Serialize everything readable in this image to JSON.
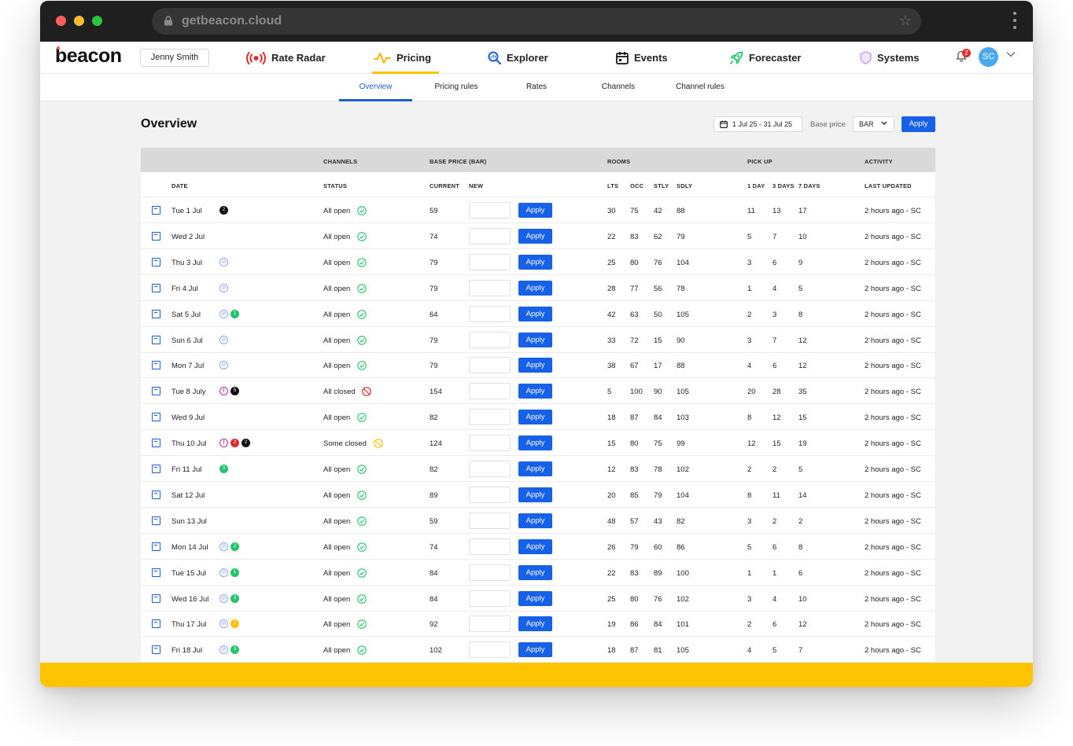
{
  "browser": {
    "url": "getbeacon.cloud"
  },
  "app": {
    "logo": "beacon",
    "user_name": "Jenny Smith",
    "nav": [
      {
        "label": "Rate Radar",
        "icon": "radar-icon"
      },
      {
        "label": "Pricing",
        "icon": "pulse-icon",
        "active": true
      },
      {
        "label": "Explorer",
        "icon": "magnifier-chart-icon"
      },
      {
        "label": "Events",
        "icon": "calendar-icon"
      },
      {
        "label": "Forecaster",
        "icon": "rocket-icon"
      },
      {
        "label": "Systems",
        "icon": "shield-icon"
      }
    ],
    "notifications_count": "2",
    "avatar_initials": "SC"
  },
  "subnav": {
    "tabs": [
      {
        "label": "Overview",
        "active": true
      },
      {
        "label": "Pricing rules"
      },
      {
        "label": "Rates"
      },
      {
        "label": "Channels"
      },
      {
        "label": "Channel rules"
      }
    ]
  },
  "overview": {
    "title": "Overview",
    "date_range": "1 Jul 25 - 31 Jul 25",
    "base_price_label": "Base price",
    "base_price_value": "BAR",
    "apply_label": "Apply"
  },
  "colors": {
    "accent_blue": "#1760e8",
    "active_tab_yellow": "#ffc400",
    "status_green": "#22c56b",
    "status_red": "#e02828"
  },
  "table": {
    "group_headers": {
      "channels": "CHANNELS",
      "base_price": "BASE PRICE (BAR)",
      "rooms": "ROOMS",
      "pick_up": "PICK UP",
      "activity": "ACTIVITY"
    },
    "columns": {
      "date": "DATE",
      "status": "STATUS",
      "current": "CURRENT",
      "new": "NEW",
      "lts": "LTS",
      "occ": "OCC",
      "stly": "STLY",
      "sdly": "SDLY",
      "day1": "1 DAY",
      "days3": "3 DAYS",
      "days7": "7 DAYS",
      "last_updated": "LAST UPDATED"
    },
    "row_apply_label": "Apply",
    "rows": [
      {
        "date": "Tue 1 Jul",
        "badges": [
          {
            "type": "dark",
            "text": "2"
          }
        ],
        "status": "All open",
        "status_type": "open",
        "current": "59",
        "lts": "30",
        "occ": "75",
        "stly": "42",
        "sdly": "88",
        "d1": "11",
        "d3": "13",
        "d7": "17",
        "updated": "2 hours ago - SC"
      },
      {
        "date": "Wed 2 Jul",
        "badges": [],
        "status": "All open",
        "status_type": "open",
        "current": "74",
        "lts": "22",
        "occ": "83",
        "stly": "62",
        "sdly": "79",
        "d1": "5",
        "d3": "7",
        "d7": "10",
        "updated": "2 hours ago - SC"
      },
      {
        "date": "Thu 3 Jul",
        "badges": [
          {
            "type": "no-entry",
            "text": "⊘"
          }
        ],
        "status": "All open",
        "status_type": "open",
        "current": "79",
        "lts": "25",
        "occ": "80",
        "stly": "76",
        "sdly": "104",
        "d1": "3",
        "d3": "6",
        "d7": "9",
        "updated": "2 hours ago - SC"
      },
      {
        "date": "Fri 4 Jul",
        "badges": [
          {
            "type": "no-entry",
            "text": "⊘"
          }
        ],
        "status": "All open",
        "status_type": "open",
        "current": "79",
        "lts": "28",
        "occ": "77",
        "stly": "56",
        "sdly": "78",
        "d1": "1",
        "d3": "4",
        "d7": "5",
        "updated": "2 hours ago - SC"
      },
      {
        "date": "Sat 5 Jul",
        "badges": [
          {
            "type": "no-entry",
            "text": "⊘"
          },
          {
            "type": "green",
            "text": "1"
          }
        ],
        "status": "All open",
        "status_type": "open",
        "current": "64",
        "lts": "42",
        "occ": "63",
        "stly": "50",
        "sdly": "105",
        "d1": "2",
        "d3": "3",
        "d7": "8",
        "updated": "2 hours ago - SC"
      },
      {
        "date": "Sun 6 Jul",
        "badges": [
          {
            "type": "no-entry",
            "text": "⊘"
          }
        ],
        "status": "All open",
        "status_type": "open",
        "current": "79",
        "lts": "33",
        "occ": "72",
        "stly": "15",
        "sdly": "90",
        "d1": "3",
        "d3": "7",
        "d7": "12",
        "updated": "2 hours ago - SC"
      },
      {
        "date": "Mon 7 Jul",
        "badges": [
          {
            "type": "no-entry",
            "text": "⊘"
          }
        ],
        "status": "All open",
        "status_type": "open",
        "current": "79",
        "lts": "38",
        "occ": "67",
        "stly": "17",
        "sdly": "88",
        "d1": "4",
        "d3": "6",
        "d7": "12",
        "updated": "2 hours ago - SC"
      },
      {
        "date": "Tue 8 July",
        "badges": [
          {
            "type": "alert",
            "text": "!"
          },
          {
            "type": "dark",
            "text": "5"
          }
        ],
        "status": "All closed",
        "status_type": "closed",
        "current": "154",
        "lts": "5",
        "occ": "100",
        "stly": "90",
        "sdly": "105",
        "d1": "20",
        "d3": "28",
        "d7": "35",
        "updated": "2 hours ago - SC"
      },
      {
        "date": "Wed 9 Jul",
        "badges": [],
        "status": "All open",
        "status_type": "open",
        "current": "82",
        "lts": "18",
        "occ": "87",
        "stly": "84",
        "sdly": "103",
        "d1": "8",
        "d3": "12",
        "d7": "15",
        "updated": "2 hours ago - SC"
      },
      {
        "date": "Thu 10 Jul",
        "badges": [
          {
            "type": "alert",
            "text": "!"
          },
          {
            "type": "red",
            "text": "2"
          },
          {
            "type": "dark",
            "text": "2"
          }
        ],
        "status": "Some closed",
        "status_type": "some",
        "current": "124",
        "lts": "15",
        "occ": "80",
        "stly": "75",
        "sdly": "99",
        "d1": "12",
        "d3": "15",
        "d7": "19",
        "updated": "2 hours ago - SC"
      },
      {
        "date": "Fri 11 Jul",
        "badges": [
          {
            "type": "green",
            "text": "3"
          }
        ],
        "status": "All open",
        "status_type": "open",
        "current": "82",
        "lts": "12",
        "occ": "83",
        "stly": "78",
        "sdly": "102",
        "d1": "2",
        "d3": "2",
        "d7": "5",
        "updated": "2 hours ago - SC"
      },
      {
        "date": "Sat 12 Jul",
        "badges": [],
        "status": "All open",
        "status_type": "open",
        "current": "89",
        "lts": "20",
        "occ": "85",
        "stly": "79",
        "sdly": "104",
        "d1": "8",
        "d3": "11",
        "d7": "14",
        "updated": "2 hours ago - SC"
      },
      {
        "date": "Sun 13 Jul",
        "badges": [],
        "status": "All open",
        "status_type": "open",
        "current": "59",
        "lts": "48",
        "occ": "57",
        "stly": "43",
        "sdly": "82",
        "d1": "3",
        "d3": "2",
        "d7": "2",
        "updated": "2 hours ago - SC"
      },
      {
        "date": "Mon 14 Jul",
        "badges": [
          {
            "type": "no-entry",
            "text": "⊘"
          },
          {
            "type": "green",
            "text": "2"
          }
        ],
        "status": "All open",
        "status_type": "open",
        "current": "74",
        "lts": "26",
        "occ": "79",
        "stly": "60",
        "sdly": "86",
        "d1": "5",
        "d3": "6",
        "d7": "8",
        "updated": "2 hours ago - SC"
      },
      {
        "date": "Tue 15 Jul",
        "badges": [
          {
            "type": "no-entry",
            "text": "⊘"
          },
          {
            "type": "green",
            "text": "1"
          }
        ],
        "status": "All open",
        "status_type": "open",
        "current": "84",
        "lts": "22",
        "occ": "83",
        "stly": "89",
        "sdly": "100",
        "d1": "1",
        "d3": "1",
        "d7": "6",
        "updated": "2 hours ago - SC"
      },
      {
        "date": "Wed 16 Jul",
        "badges": [
          {
            "type": "no-entry",
            "text": "⊘"
          },
          {
            "type": "green",
            "text": "3"
          }
        ],
        "status": "All open",
        "status_type": "open",
        "current": "84",
        "lts": "25",
        "occ": "80",
        "stly": "76",
        "sdly": "102",
        "d1": "3",
        "d3": "4",
        "d7": "10",
        "updated": "2 hours ago - SC"
      },
      {
        "date": "Thu 17 Jul",
        "badges": [
          {
            "type": "no-entry",
            "text": "⊘"
          },
          {
            "type": "yellow",
            "text": "1"
          }
        ],
        "status": "All open",
        "status_type": "open",
        "current": "92",
        "lts": "19",
        "occ": "86",
        "stly": "84",
        "sdly": "101",
        "d1": "2",
        "d3": "6",
        "d7": "12",
        "updated": "2 hours ago - SC"
      },
      {
        "date": "Fri 18 Jul",
        "badges": [
          {
            "type": "no-entry",
            "text": "⊘"
          },
          {
            "type": "green",
            "text": "3"
          }
        ],
        "status": "All open",
        "status_type": "open",
        "current": "102",
        "lts": "18",
        "occ": "87",
        "stly": "81",
        "sdly": "105",
        "d1": "4",
        "d3": "5",
        "d7": "7",
        "updated": "2 hours ago - SC"
      }
    ]
  }
}
